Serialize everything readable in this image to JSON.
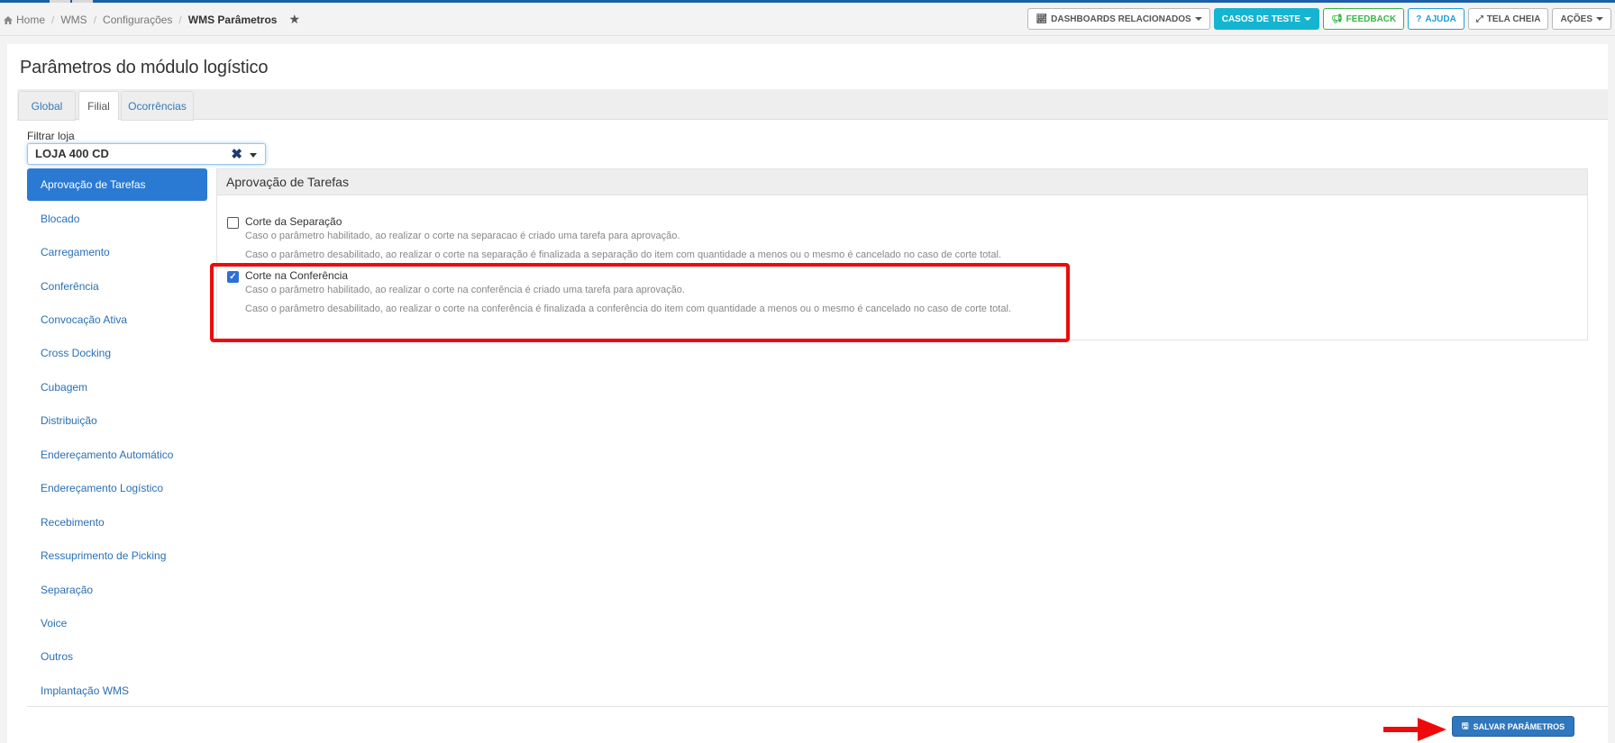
{
  "breadcrumb": {
    "home": "Home",
    "wms": "WMS",
    "config": "Configurações",
    "current": "WMS Parâmetros"
  },
  "toolbar": {
    "dashboards": "DASHBOARDS RELACIONADOS",
    "casos": "CASOS DE TESTE",
    "feedback": "FEEDBACK",
    "ajuda": "AJUDA",
    "tela": "TELA CHEIA",
    "acoes": "AÇÕES"
  },
  "page": {
    "title": "Parâmetros do módulo logístico"
  },
  "tabs": [
    "Global",
    "Filial",
    "Ocorrências"
  ],
  "filter": {
    "label": "Filtrar loja",
    "value": "LOJA 400 CD"
  },
  "sidebar": [
    "Aprovação de Tarefas",
    "Blocado",
    "Carregamento",
    "Conferência",
    "Convocação Ativa",
    "Cross Docking",
    "Cubagem",
    "Distribuição",
    "Endereçamento Automático",
    "Endereçamento Logístico",
    "Recebimento",
    "Ressuprimento de Picking",
    "Separação",
    "Voice",
    "Outros",
    "Implantação WMS"
  ],
  "section": {
    "title": "Aprovação de Tarefas",
    "params": [
      {
        "label": "Corte da Separação",
        "checked": false,
        "desc1": "Caso o parâmetro habilitado, ao realizar o corte na separacao é criado uma tarefa para aprovação.",
        "desc2": "Caso o parâmetro desabilitado, ao realizar o corte na separação é finalizada a separação do item com quantidade a menos ou o mesmo é cancelado no caso de corte total."
      },
      {
        "label": "Corte na Conferência",
        "checked": true,
        "desc1": "Caso o parâmetro habilitado, ao realizar o corte na conferência é criado uma tarefa para aprovação.",
        "desc2": "Caso o parâmetro desabilitado, ao realizar o corte na conferência é finalizada a conferência do item com quantidade a menos ou o mesmo é cancelado no caso de corte total."
      }
    ]
  },
  "save": {
    "label": "SALVAR PARÂMETROS"
  },
  "colors": {
    "accent": "#2a7ad3",
    "highlight": "#ee0a0a"
  }
}
